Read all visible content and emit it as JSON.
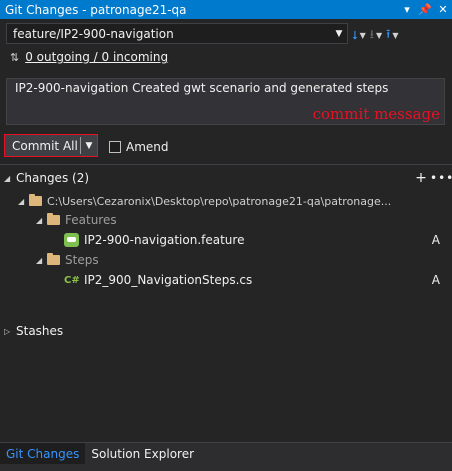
{
  "window": {
    "title": "Git Changes - patronage21-qa"
  },
  "branch": {
    "current": "feature/IP2-900-navigation"
  },
  "sync": {
    "status": "0 outgoing / 0 incoming"
  },
  "commit": {
    "message": "IP2-900-navigation Created gwt scenario and generated steps",
    "annotation": "commit message",
    "button_label": "Commit All",
    "amend_label": "Amend"
  },
  "changes": {
    "header": "Changes (2)",
    "root_path": "C:\\Users\\Cezaronix\\Desktop\\repo\\patronage21-qa\\patronage...",
    "folders": [
      {
        "name": "Features",
        "files": [
          {
            "name": "IP2-900-navigation.feature",
            "status": "A",
            "icon": "feature-file-icon"
          }
        ]
      },
      {
        "name": "Steps",
        "files": [
          {
            "name": "IP2_900_NavigationSteps.cs",
            "status": "A",
            "icon": "csharp-file-icon"
          }
        ]
      }
    ]
  },
  "stashes": {
    "header": "Stashes"
  },
  "tabs": [
    {
      "label": "Git Changes",
      "active": true
    },
    {
      "label": "Solution Explorer",
      "active": false
    }
  ],
  "colors": {
    "accent": "#007acc",
    "annotation": "#e81123",
    "link_blue": "#3794ff"
  }
}
